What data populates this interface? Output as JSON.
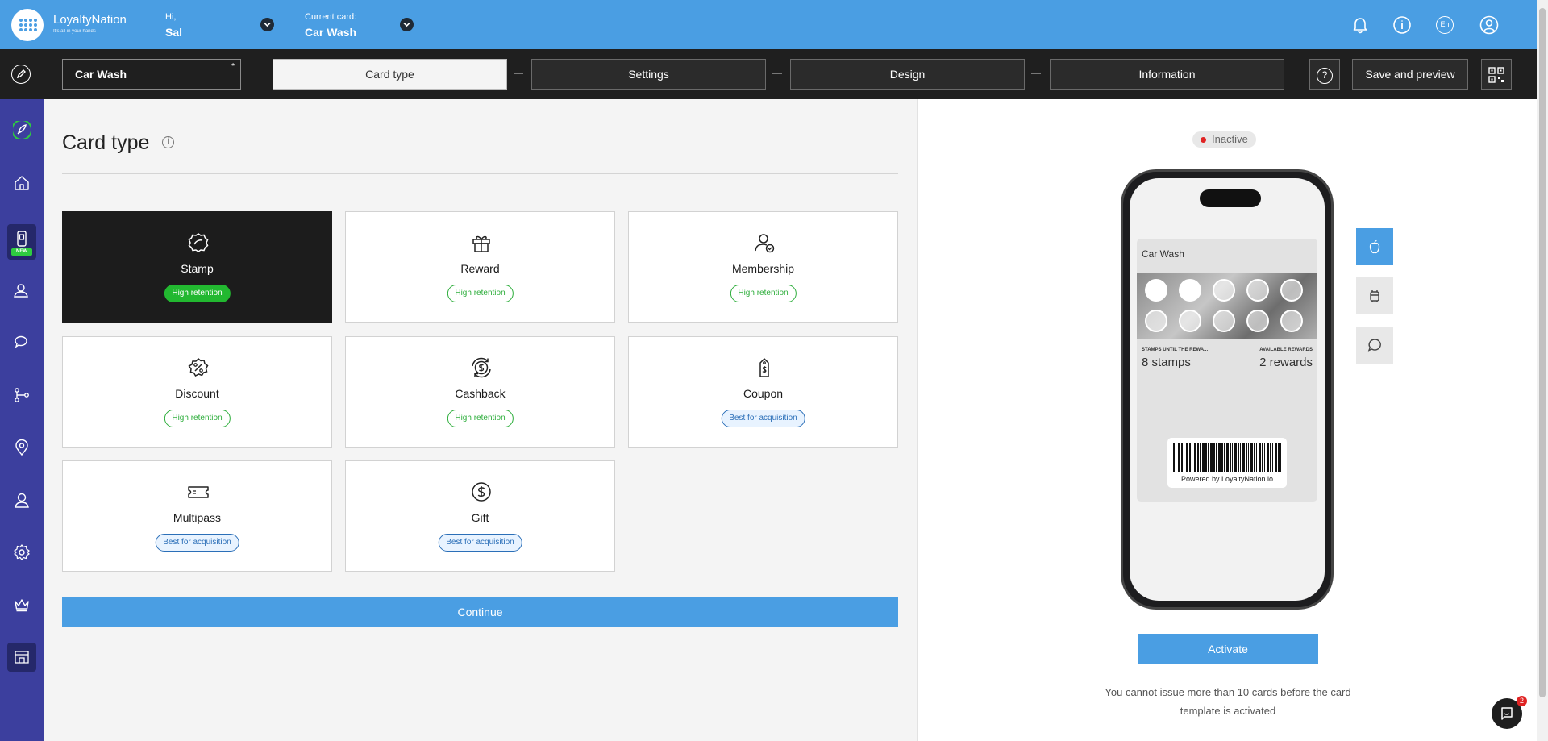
{
  "header": {
    "brand": "LoyaltyNation",
    "tagline": "It's all in your hands",
    "greeting": "Hi,",
    "user_name": "Sal",
    "current_card_label": "Current card:",
    "current_card": "Car Wash",
    "lang": "En"
  },
  "toolbar": {
    "card_name": "Car Wash",
    "required_mark": "*",
    "steps": [
      "Card type",
      "Settings",
      "Design",
      "Information"
    ],
    "help": "?",
    "save_preview": "Save and preview"
  },
  "sidebar": {
    "items": [
      "rocket-icon",
      "home-icon",
      "phone-card-icon",
      "users-icon",
      "chat-icon",
      "flow-icon",
      "location-icon",
      "user-icon",
      "settings-icon",
      "crown-icon",
      "store-icon"
    ],
    "new_badge": "NEW"
  },
  "main": {
    "title": "Card type",
    "info_icon": "i",
    "cards": [
      {
        "name": "Stamp",
        "badge": "High retention",
        "badge_type": "green",
        "selected": true,
        "icon": "stamp-icon"
      },
      {
        "name": "Reward",
        "badge": "High retention",
        "badge_type": "green",
        "selected": false,
        "icon": "gift-box-icon"
      },
      {
        "name": "Membership",
        "badge": "High retention",
        "badge_type": "green",
        "selected": false,
        "icon": "membership-icon"
      },
      {
        "name": "Discount",
        "badge": "High retention",
        "badge_type": "green",
        "selected": false,
        "icon": "discount-icon"
      },
      {
        "name": "Cashback",
        "badge": "High retention",
        "badge_type": "green",
        "selected": false,
        "icon": "cashback-icon"
      },
      {
        "name": "Coupon",
        "badge": "Best for acquisition",
        "badge_type": "blue",
        "selected": false,
        "icon": "coupon-icon"
      },
      {
        "name": "Multipass",
        "badge": "Best for acquisition",
        "badge_type": "blue",
        "selected": false,
        "icon": "ticket-icon"
      },
      {
        "name": "Gift",
        "badge": "Best for acquisition",
        "badge_type": "blue",
        "selected": false,
        "icon": "dollar-icon"
      }
    ],
    "continue": "Continue"
  },
  "preview": {
    "status": "Inactive",
    "pass_name": "Car Wash",
    "field1_label": "STAMPS UNTIL THE REWA...",
    "field1_value": "8 stamps",
    "field2_label": "AVAILABLE REWARDS",
    "field2_value": "2 rewards",
    "stamps_collected": 2,
    "stamps_total": 10,
    "powered_by": "Powered by LoyaltyNation.io",
    "activate": "Activate",
    "note": "You cannot issue more than 10 cards before the card template is activated",
    "chat_count": "2"
  },
  "colors": {
    "accent": "#4a9ee3",
    "sidebar": "#3c3f9e",
    "toolbar": "#1f1f1f",
    "retention": "#2eae3c",
    "acquisition": "#2b6fb8"
  }
}
